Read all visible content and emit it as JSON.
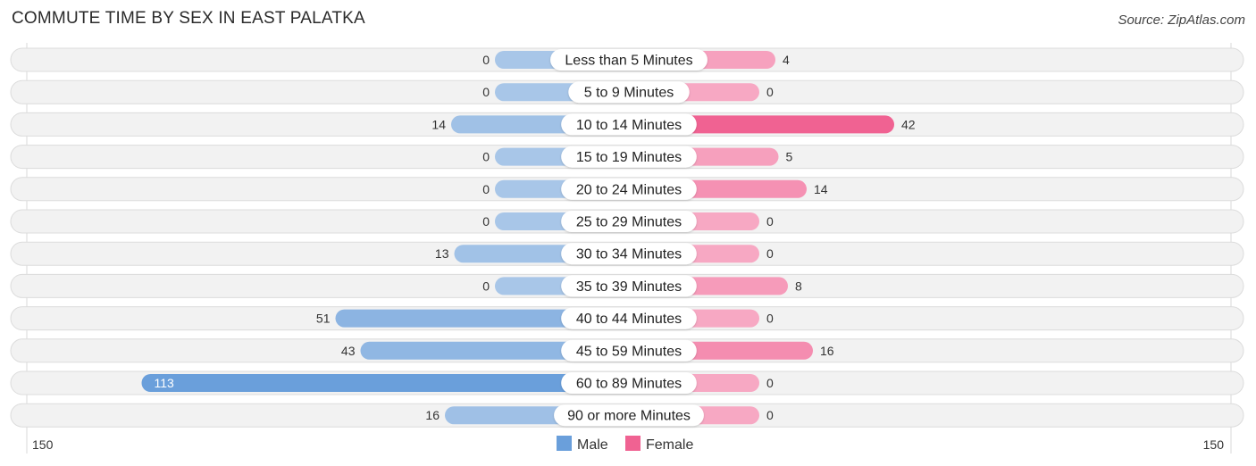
{
  "title": "COMMUTE TIME BY SEX IN EAST PALATKA",
  "source": "Source: ZipAtlas.com",
  "colors": {
    "male_light": "#a8c6e8",
    "male_dark": "#6a9fdb",
    "female_light": "#f7a8c3",
    "female_dark": "#f06292",
    "row_bg": "#f2f2f2"
  },
  "chart_data": {
    "type": "bar",
    "orientation": "horizontal-diverging",
    "title": "COMMUTE TIME BY SEX IN EAST PALATKA",
    "categories": [
      "Less than 5 Minutes",
      "5 to 9 Minutes",
      "10 to 14 Minutes",
      "15 to 19 Minutes",
      "20 to 24 Minutes",
      "25 to 29 Minutes",
      "30 to 34 Minutes",
      "35 to 39 Minutes",
      "40 to 44 Minutes",
      "45 to 59 Minutes",
      "60 to 89 Minutes",
      "90 or more Minutes"
    ],
    "series": [
      {
        "name": "Male",
        "side": "left",
        "values": [
          0,
          0,
          14,
          0,
          0,
          0,
          13,
          0,
          51,
          43,
          113,
          16
        ]
      },
      {
        "name": "Female",
        "side": "right",
        "values": [
          4,
          0,
          42,
          5,
          14,
          0,
          0,
          8,
          0,
          16,
          0,
          0
        ]
      }
    ],
    "axis": {
      "left_label": "150",
      "right_label": "150",
      "max": 150
    },
    "legend": {
      "position": "bottom-center",
      "entries": [
        "Male",
        "Female"
      ]
    },
    "grid": false
  }
}
